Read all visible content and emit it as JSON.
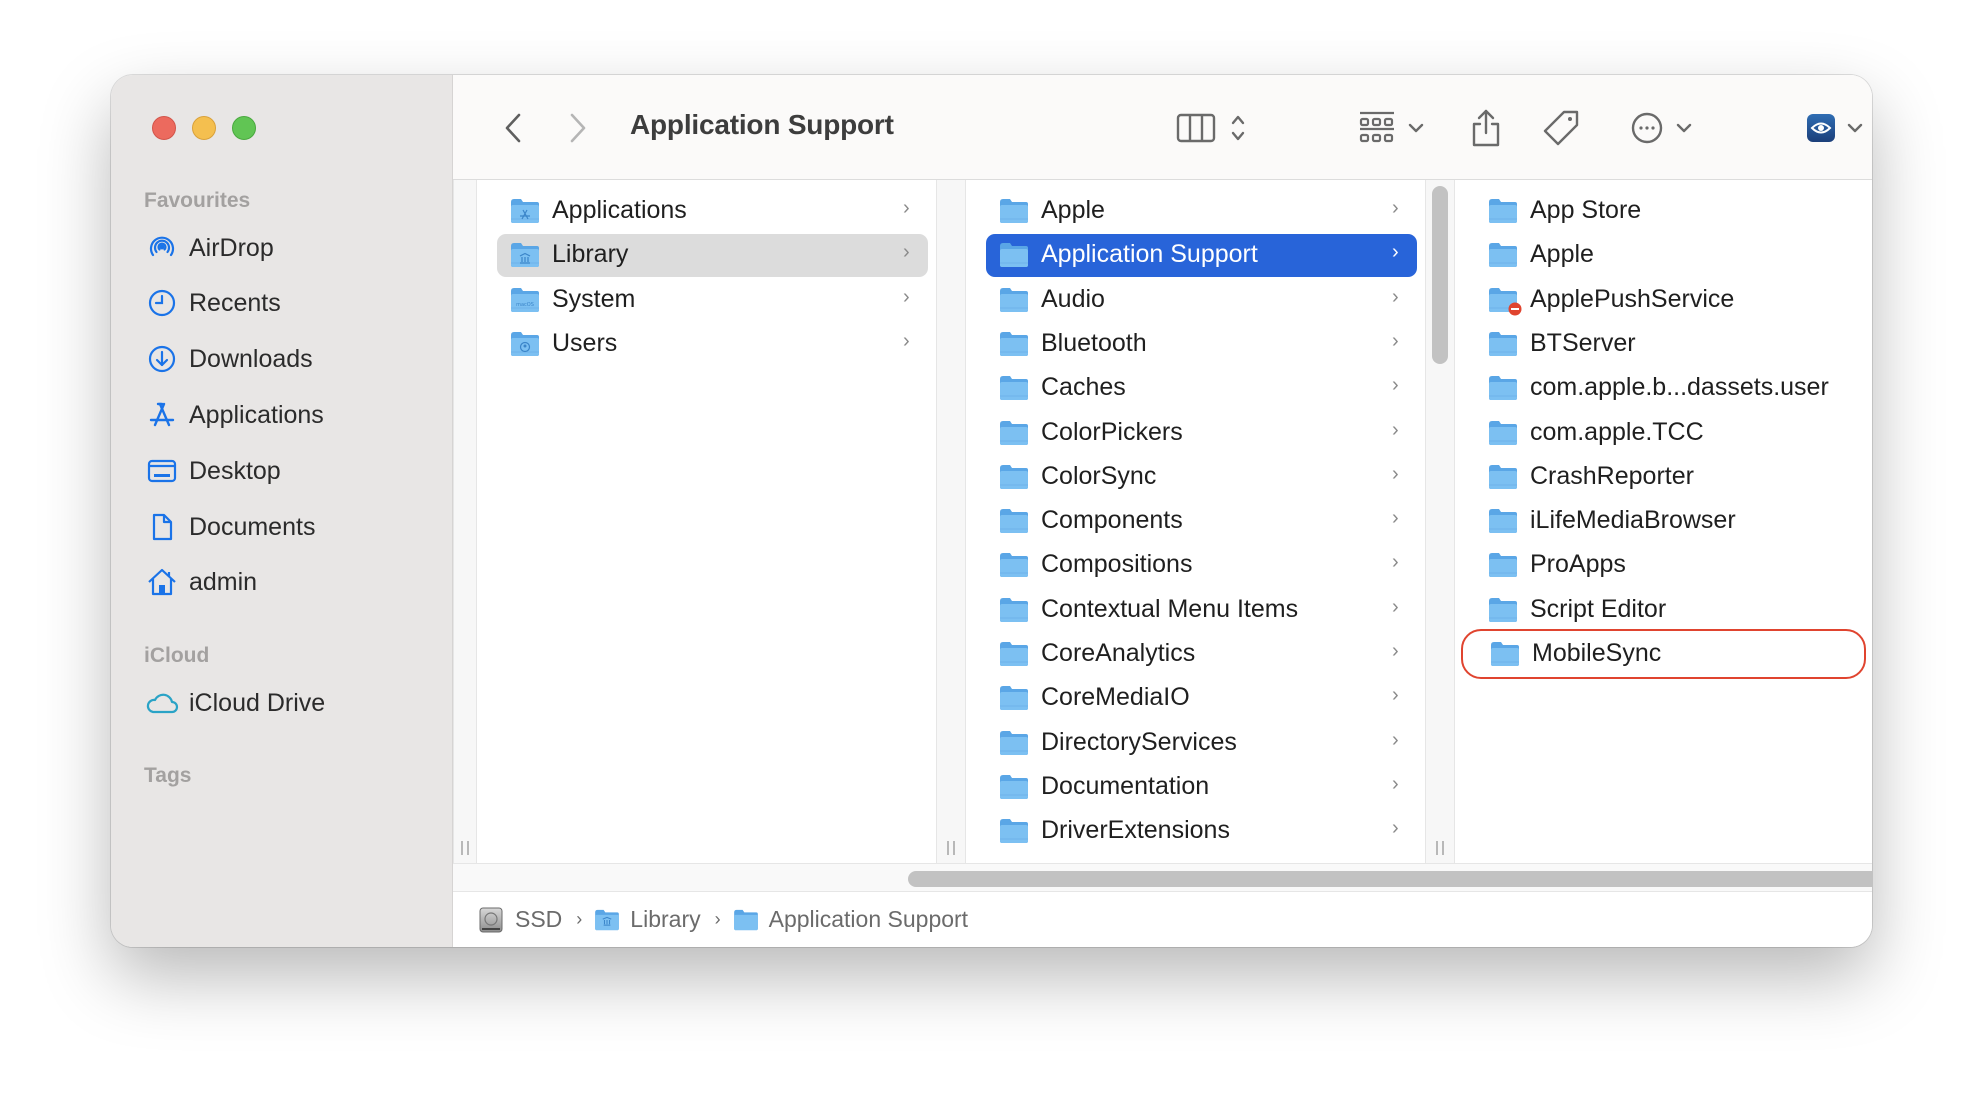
{
  "window": {
    "title": "Application Support",
    "traffic_lights": [
      "close",
      "minimize",
      "zoom"
    ]
  },
  "sidebar": {
    "sections": [
      {
        "label": "Favourites",
        "items": [
          {
            "label": "AirDrop",
            "icon": "airdrop-icon"
          },
          {
            "label": "Recents",
            "icon": "clock-icon"
          },
          {
            "label": "Downloads",
            "icon": "download-icon"
          },
          {
            "label": "Applications",
            "icon": "applications-icon"
          },
          {
            "label": "Desktop",
            "icon": "desktop-icon"
          },
          {
            "label": "Documents",
            "icon": "document-icon"
          },
          {
            "label": "admin",
            "icon": "home-icon"
          }
        ]
      },
      {
        "label": "iCloud",
        "items": [
          {
            "label": "iCloud Drive",
            "icon": "cloud-icon"
          }
        ]
      },
      {
        "label": "Tags",
        "items": []
      }
    ]
  },
  "toolbar": {
    "back": "back",
    "forward": "forward",
    "title": "Application Support",
    "view_mode": "column-view",
    "group": "group-by",
    "share": "share",
    "tags": "tags",
    "more": "more-actions",
    "preview": "quick-look",
    "search": "search"
  },
  "columns": [
    {
      "items": [
        {
          "name": "Applications",
          "icon": "applications-folder",
          "has_children": true
        },
        {
          "name": "Library",
          "icon": "library-folder",
          "has_children": true,
          "selected": "inactive"
        },
        {
          "name": "System",
          "icon": "macos-folder",
          "has_children": true
        },
        {
          "name": "Users",
          "icon": "users-folder",
          "has_children": true
        }
      ]
    },
    {
      "items": [
        {
          "name": "Apple",
          "has_children": true
        },
        {
          "name": "Application Support",
          "has_children": true,
          "selected": "active"
        },
        {
          "name": "Audio",
          "has_children": true
        },
        {
          "name": "Bluetooth",
          "has_children": true
        },
        {
          "name": "Caches",
          "has_children": true
        },
        {
          "name": "ColorPickers",
          "has_children": true
        },
        {
          "name": "ColorSync",
          "has_children": true
        },
        {
          "name": "Components",
          "has_children": true
        },
        {
          "name": "Compositions",
          "has_children": true
        },
        {
          "name": "Contextual Menu Items",
          "has_children": true
        },
        {
          "name": "CoreAnalytics",
          "has_children": true
        },
        {
          "name": "CoreMediaIO",
          "has_children": true
        },
        {
          "name": "DirectoryServices",
          "has_children": true
        },
        {
          "name": "Documentation",
          "has_children": true
        },
        {
          "name": "DriverExtensions",
          "has_children": true
        }
      ]
    },
    {
      "items": [
        {
          "name": "App Store"
        },
        {
          "name": "Apple"
        },
        {
          "name": "ApplePushService",
          "badge": "no-access"
        },
        {
          "name": "BTServer"
        },
        {
          "name": "com.apple.b...dassets.user"
        },
        {
          "name": "com.apple.TCC"
        },
        {
          "name": "CrashReporter"
        },
        {
          "name": "iLifeMediaBrowser"
        },
        {
          "name": "ProApps"
        },
        {
          "name": "Script Editor"
        },
        {
          "name": "MobileSync",
          "highlighted": true
        }
      ]
    }
  ],
  "pathbar": [
    {
      "label": "SSD",
      "icon": "disk-icon"
    },
    {
      "label": "Library",
      "icon": "library-folder-icon"
    },
    {
      "label": "Application Support",
      "icon": "folder-icon"
    }
  ],
  "colors": {
    "selection_active": "#2864d9",
    "selection_inactive": "#dcdcdc",
    "highlight_outline": "#e0442f",
    "sidebar_icon": "#1a73e8",
    "icloud_icon": "#2aa3c6",
    "folder": "#69b5ec"
  }
}
